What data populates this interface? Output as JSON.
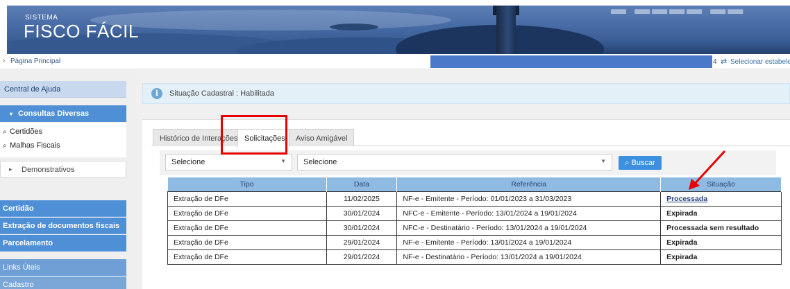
{
  "header": {
    "system_small": "SISTEMA",
    "system_title": "FISCO FÁCIL"
  },
  "breadcrumb": {
    "home_label": "Página Principal"
  },
  "establishment": {
    "number": "4",
    "select_label": "Selecionar estabelecime"
  },
  "sidebar": {
    "help": "Central de Ajuda",
    "consultas": "Consultas Diversas",
    "sub_items": [
      "Certidões",
      "Malhas Fiscais"
    ],
    "demonstrativos": "Demonstrativos",
    "bottom_items": [
      "Certidão",
      "Extração de documentos fiscais",
      "Parcelamento"
    ],
    "links": "Links Úteis",
    "cadastro": "Cadastro"
  },
  "alert": {
    "text": "Situação Cadastral : Habilitada"
  },
  "tabs": [
    {
      "label": "Histórico de Interações",
      "active": false
    },
    {
      "label": "Solicitações",
      "active": true
    },
    {
      "label": "Aviso Amigável",
      "active": false
    }
  ],
  "filters": {
    "select1": "Selecione",
    "select2": "Selecione",
    "search_button": "Buscar"
  },
  "table": {
    "headers": [
      "Tipo",
      "Data",
      "Referência",
      "Situação"
    ],
    "rows": [
      [
        "Extração de DFe",
        "11/02/2025",
        "NF-e - Emitente - Período: 01/01/2023 a 31/03/2023",
        "Processada"
      ],
      [
        "Extração de DFe",
        "30/01/2024",
        "NFC-e - Emitente - Período: 13/01/2024 a 19/01/2024",
        "Expirada"
      ],
      [
        "Extração de DFe",
        "30/01/2024",
        "NFC-e - Destinatário - Período: 13/01/2024 a 19/01/2024",
        "Processada sem resultado"
      ],
      [
        "Extração de DFe",
        "29/01/2024",
        "NF-e - Emitente - Período: 13/01/2024 a 19/01/2024",
        "Expirada"
      ],
      [
        "Extração de DFe",
        "29/01/2024",
        "NF-e - Destinatário - Período: 13/01/2024 a 19/01/2024",
        "Expirada"
      ]
    ]
  },
  "colors": {
    "accent_blue": "#4f8fd6",
    "annotation_red": "#e60000",
    "table_header": "#8fbbe3",
    "button_blue": "#3d8fe0"
  }
}
